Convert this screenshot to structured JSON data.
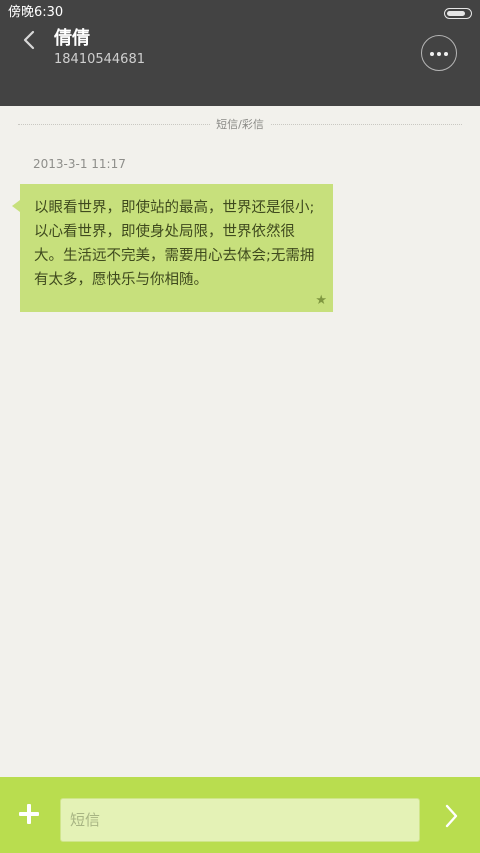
{
  "status_bar": {
    "time": "傍晚6:30",
    "battery_level": 0.8
  },
  "header": {
    "back_icon": "chevron-left-icon",
    "contact_name": "倩倩",
    "contact_number": "18410544681",
    "more_icon": "more-dots-icon"
  },
  "conversation": {
    "channel_label": "短信/彩信",
    "messages": [
      {
        "timestamp": "2013-3-1 11:17",
        "text": "以眼看世界，即使站的最高，世界还是很小;以心看世界，即使身处局限，世界依然很大。生活远不完美，需要用心去体会;无需拥有太多，愿快乐与你相随。",
        "starred": true,
        "star_icon": "star-icon"
      }
    ]
  },
  "compose": {
    "add_icon": "plus-icon",
    "placeholder": "短信",
    "value": "",
    "send_icon": "send-chevron-icon"
  },
  "colors": {
    "header_bg": "#434343",
    "conversation_bg": "#f2f1ec",
    "bubble_bg": "#c7e07c",
    "compose_bar_bg": "#b9dd4f",
    "input_bg": "#e4f2b6"
  }
}
